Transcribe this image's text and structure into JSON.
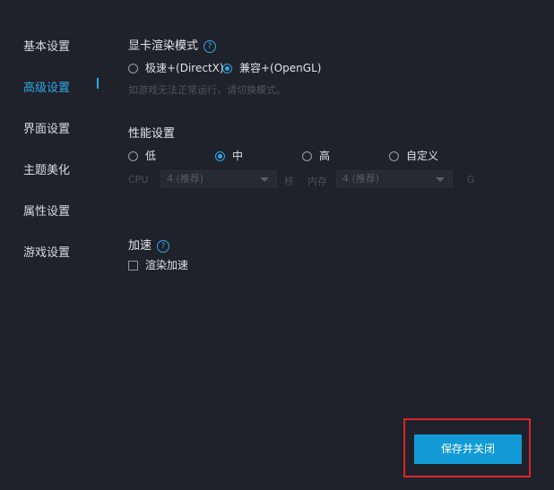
{
  "sidebar": {
    "items": [
      {
        "label": "基本设置"
      },
      {
        "label": "高级设置"
      },
      {
        "label": "界面设置"
      },
      {
        "label": "主题美化"
      },
      {
        "label": "属性设置"
      },
      {
        "label": "游戏设置"
      }
    ],
    "active_index": 1
  },
  "render_mode": {
    "title": "显卡渲染模式",
    "options": [
      {
        "label": "极速+(DirectX)",
        "checked": false
      },
      {
        "label": "兼容+(OpenGL)",
        "checked": true
      }
    ],
    "hint": "如游戏无法正常运行，请切换模式。"
  },
  "performance": {
    "title": "性能设置",
    "options": [
      {
        "label": "低",
        "checked": false
      },
      {
        "label": "中",
        "checked": true
      },
      {
        "label": "高",
        "checked": false
      },
      {
        "label": "自定义",
        "checked": false
      }
    ],
    "cpu_label": "CPU",
    "cpu_value": "4 (推荐)",
    "cpu_unit": "核",
    "mem_label": "内存",
    "mem_value": "4 (推荐)",
    "mem_unit": "G"
  },
  "acceleration": {
    "title": "加速",
    "checkbox_label": "渲染加速",
    "checked": false
  },
  "footer": {
    "save_label": "保存并关闭"
  },
  "colors": {
    "accent": "#2fa7e6",
    "button": "#119ad6",
    "highlight_border": "#d9262a"
  }
}
